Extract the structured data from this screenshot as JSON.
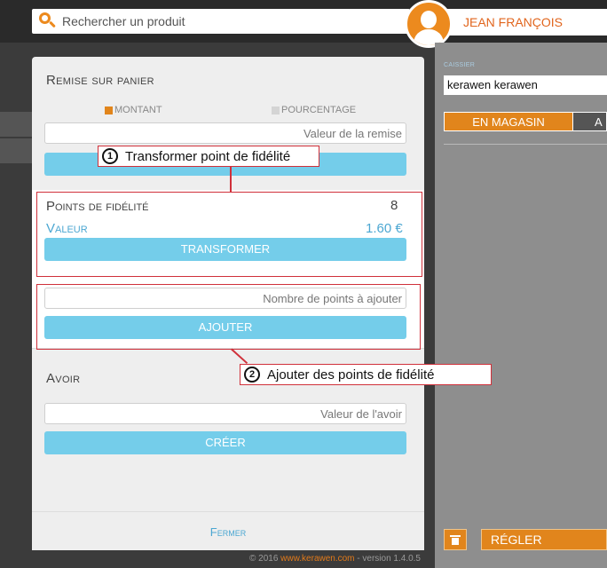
{
  "search": {
    "placeholder": "Rechercher un produit"
  },
  "user": {
    "name": "JEAN FRANÇOIS"
  },
  "cashier": {
    "label": "CAISSIER",
    "value": "kerawen kerawen"
  },
  "tabs": {
    "store": "EN MAGASIN",
    "other": "A"
  },
  "actions": {
    "pay": "RÉGLER"
  },
  "modal": {
    "discount": {
      "title": "Remise sur panier",
      "option_amount": "MONTANT",
      "option_percent": "POURCENTAGE",
      "field_placeholder": "Valeur de la remise"
    },
    "loyalty": {
      "title": "Points de fidélité",
      "points": "8",
      "value_label": "Valeur",
      "value": "1.60 €",
      "transform_button": "TRANSFORMER",
      "add_placeholder": "Nombre de points à ajouter",
      "add_button": "AJOUTER"
    },
    "credit": {
      "title": "Avoir",
      "field_placeholder": "Valeur de l'avoir",
      "create_button": "CRÉER"
    },
    "close": "Fermer",
    "copyright_prefix": "© 2016 ",
    "copyright_brand": "www.kerawen.com",
    "copyright_suffix": " - version 1.4.0.5"
  },
  "annotations": {
    "one": {
      "number": "1",
      "text": "Transformer point de fidélité"
    },
    "two": {
      "number": "2",
      "text": "Ajouter des points de fidélité"
    }
  },
  "colors": {
    "accent_orange": "#e1851c",
    "button_blue": "#74cdea",
    "annotation_red": "#d0303a"
  }
}
